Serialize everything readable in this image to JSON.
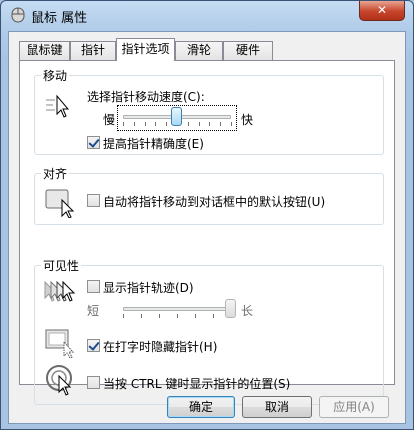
{
  "window": {
    "title": "鼠标 属性",
    "close_glyph": "✕"
  },
  "tabs": [
    {
      "label": "鼠标键"
    },
    {
      "label": "指针"
    },
    {
      "label": "指针选项"
    },
    {
      "label": "滑轮"
    },
    {
      "label": "硬件"
    }
  ],
  "motion": {
    "title": "移动",
    "speed_label": "选择指针移动速度(C):",
    "slow_label": "慢",
    "fast_label": "快",
    "speed_level": 0.5,
    "precision_label": "提高指针精确度(E)",
    "precision_checked": true
  },
  "snap": {
    "title": "对齐",
    "snap_label": "自动将指针移动到对话框中的默认按钮(U)",
    "snap_checked": false
  },
  "visibility": {
    "title": "可见性",
    "trails_label": "显示指针轨迹(D)",
    "trails_checked": false,
    "short_label": "短",
    "long_label": "长",
    "trail_level": 1.0,
    "hide_label": "在打字时隐藏指针(H)",
    "hide_checked": true,
    "ctrl_label": "当按 CTRL 键时显示指针的位置(S)",
    "ctrl_checked": false
  },
  "buttons": {
    "ok": "确定",
    "cancel": "取消",
    "apply": "应用(A)"
  }
}
